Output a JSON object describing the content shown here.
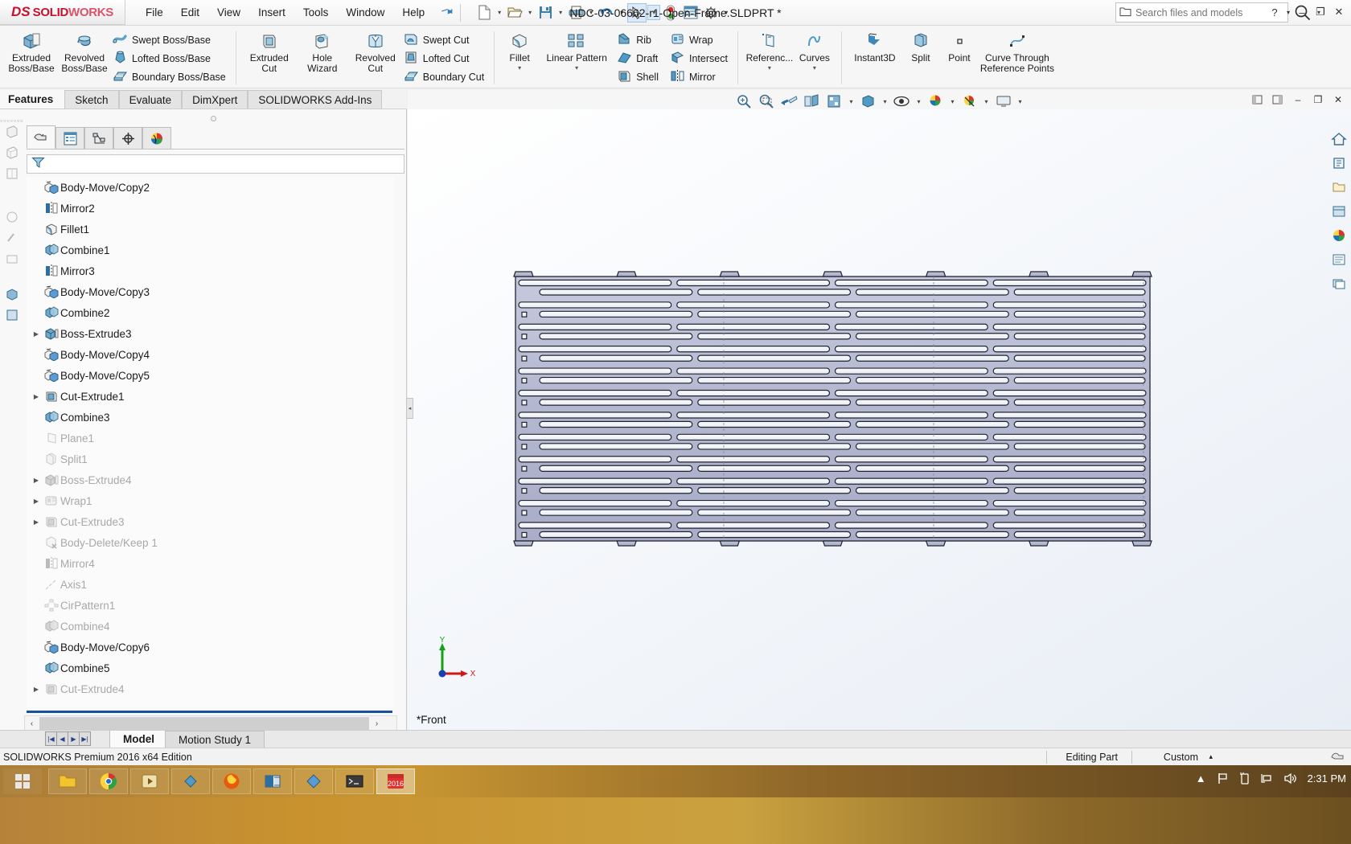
{
  "app": {
    "brand_ds": "DS",
    "brand_solid": "SOLID",
    "brand_works": "WORKS",
    "document_title": "NDC-03-06662-r1-Open-Frame.SLDPRT *",
    "accent_color": "#c8102e",
    "highlight_color": "#dce9f7"
  },
  "menubar": {
    "items": [
      "File",
      "Edit",
      "View",
      "Insert",
      "Tools",
      "Window",
      "Help"
    ]
  },
  "quick_access": {
    "items": [
      "new-document-icon",
      "open-document-icon",
      "save-icon",
      "print-icon",
      "undo-icon",
      "select-arrow-icon",
      "rebuild-icon",
      "options-list-icon",
      "settings-gear-icon"
    ]
  },
  "search": {
    "placeholder": "Search files and models",
    "value": ""
  },
  "window_controls": {
    "help": "?",
    "help_caret": "▾",
    "minimize": "–",
    "maximize": "❐",
    "close": "✕"
  },
  "ribbon": {
    "groups": [
      {
        "name": "boss-base",
        "big": [
          {
            "label_top": "Extruded",
            "label_bottom": "Boss/Base",
            "icon": "extruded-boss-icon"
          },
          {
            "label_top": "Revolved",
            "label_bottom": "Boss/Base",
            "icon": "revolved-boss-icon"
          }
        ],
        "small": [
          {
            "label": "Swept Boss/Base",
            "icon": "swept-boss-icon"
          },
          {
            "label": "Lofted Boss/Base",
            "icon": "lofted-boss-icon"
          },
          {
            "label": "Boundary Boss/Base",
            "icon": "boundary-boss-icon"
          }
        ]
      },
      {
        "name": "cut",
        "big": [
          {
            "label_top": "Extruded",
            "label_bottom": "Cut",
            "icon": "extruded-cut-icon"
          },
          {
            "label_top": "Hole",
            "label_bottom": "Wizard",
            "icon": "hole-wizard-icon"
          },
          {
            "label_top": "Revolved",
            "label_bottom": "Cut",
            "icon": "revolved-cut-icon"
          }
        ],
        "small": [
          {
            "label": "Swept Cut",
            "icon": "swept-cut-icon"
          },
          {
            "label": "Lofted Cut",
            "icon": "lofted-cut-icon"
          },
          {
            "label": "Boundary Cut",
            "icon": "boundary-cut-icon"
          }
        ]
      },
      {
        "name": "features",
        "big": [
          {
            "label_top": "Fillet",
            "label_bottom": "",
            "icon": "fillet-icon",
            "has_dropdown": true
          },
          {
            "label_top": "Linear Pattern",
            "label_bottom": "",
            "icon": "linear-pattern-icon",
            "has_dropdown": true
          }
        ],
        "small": [
          {
            "label": "Rib",
            "icon": "rib-icon"
          },
          {
            "label": "Draft",
            "icon": "draft-icon"
          },
          {
            "label": "Shell",
            "icon": "shell-icon"
          }
        ],
        "small2": [
          {
            "label": "Wrap",
            "icon": "wrap-icon"
          },
          {
            "label": "Intersect",
            "icon": "intersect-icon"
          },
          {
            "label": "Mirror",
            "icon": "mirror-icon"
          }
        ]
      },
      {
        "name": "reference",
        "big": [
          {
            "label_top": "Referenc...",
            "label_bottom": "",
            "icon": "reference-geometry-icon",
            "has_dropdown": true
          },
          {
            "label_top": "Curves",
            "label_bottom": "",
            "icon": "curves-icon",
            "has_dropdown": true
          }
        ]
      },
      {
        "name": "instant3d",
        "big": [
          {
            "label_top": "Instant3D",
            "label_bottom": "",
            "icon": "instant3d-icon"
          },
          {
            "label_top": "Split",
            "label_bottom": "",
            "icon": "split-icon"
          },
          {
            "label_top": "Point",
            "label_bottom": "",
            "icon": "point-icon"
          },
          {
            "label_top": "Curve Through",
            "label_bottom": "Reference Points",
            "icon": "curve-through-reference-points-icon"
          }
        ]
      }
    ]
  },
  "command_tabs": {
    "active": "Features",
    "items": [
      "Features",
      "Sketch",
      "Evaluate",
      "DimXpert",
      "SOLIDWORKS Add-Ins"
    ]
  },
  "feature_manager": {
    "tabs": [
      "feature-tree-icon",
      "property-manager-icon",
      "configuration-manager-icon",
      "dimxpert-manager-icon",
      "display-manager-icon"
    ],
    "active_tab_index": 0,
    "filter_placeholder": "",
    "expander": "›",
    "tree": [
      {
        "label": "Body-Move/Copy2",
        "icon": "body-move-copy-icon",
        "arrow": false,
        "suppressed": false
      },
      {
        "label": "Mirror2",
        "icon": "mirror-feature-icon",
        "arrow": false,
        "suppressed": false
      },
      {
        "label": "Fillet1",
        "icon": "fillet-feature-icon",
        "arrow": false,
        "suppressed": false
      },
      {
        "label": "Combine1",
        "icon": "combine-feature-icon",
        "arrow": false,
        "suppressed": false
      },
      {
        "label": "Mirror3",
        "icon": "mirror-feature-icon",
        "arrow": false,
        "suppressed": false
      },
      {
        "label": "Body-Move/Copy3",
        "icon": "body-move-copy-icon",
        "arrow": false,
        "suppressed": false
      },
      {
        "label": "Combine2",
        "icon": "combine-feature-icon",
        "arrow": false,
        "suppressed": false
      },
      {
        "label": "Boss-Extrude3",
        "icon": "boss-extrude-icon",
        "arrow": true,
        "suppressed": false
      },
      {
        "label": "Body-Move/Copy4",
        "icon": "body-move-copy-icon",
        "arrow": false,
        "suppressed": false
      },
      {
        "label": "Body-Move/Copy5",
        "icon": "body-move-copy-icon",
        "arrow": false,
        "suppressed": false
      },
      {
        "label": "Cut-Extrude1",
        "icon": "cut-extrude-icon",
        "arrow": true,
        "suppressed": false
      },
      {
        "label": "Combine3",
        "icon": "combine-feature-icon",
        "arrow": false,
        "suppressed": false
      },
      {
        "label": "Plane1",
        "icon": "plane-icon",
        "arrow": false,
        "suppressed": true
      },
      {
        "label": "Split1",
        "icon": "split-feature-icon",
        "arrow": false,
        "suppressed": true
      },
      {
        "label": "Boss-Extrude4",
        "icon": "boss-extrude-icon",
        "arrow": true,
        "suppressed": true
      },
      {
        "label": "Wrap1",
        "icon": "wrap-feature-icon",
        "arrow": true,
        "suppressed": true
      },
      {
        "label": "Cut-Extrude3",
        "icon": "cut-extrude-icon",
        "arrow": true,
        "suppressed": true
      },
      {
        "label": "Body-Delete/Keep 1",
        "icon": "body-delete-keep-icon",
        "arrow": false,
        "suppressed": true
      },
      {
        "label": "Mirror4",
        "icon": "mirror-feature-icon",
        "arrow": false,
        "suppressed": true
      },
      {
        "label": "Axis1",
        "icon": "axis-icon",
        "arrow": false,
        "suppressed": true
      },
      {
        "label": "CirPattern1",
        "icon": "circular-pattern-icon",
        "arrow": false,
        "suppressed": true
      },
      {
        "label": "Combine4",
        "icon": "combine-feature-icon",
        "arrow": false,
        "suppressed": true
      },
      {
        "label": "Body-Move/Copy6",
        "icon": "body-move-copy-icon",
        "arrow": false,
        "suppressed": false
      },
      {
        "label": "Combine5",
        "icon": "combine-feature-icon",
        "arrow": false,
        "suppressed": false
      },
      {
        "label": "Cut-Extrude4",
        "icon": "cut-extrude-icon",
        "arrow": true,
        "suppressed": true
      }
    ]
  },
  "document_tabs": {
    "active": "Model",
    "items": [
      "Model",
      "Motion Study 1"
    ],
    "nav_buttons": [
      "first",
      "prev",
      "next",
      "last"
    ]
  },
  "graphics": {
    "view_label": "*Front",
    "triad": {
      "x_axis": "X",
      "y_axis": "Y"
    },
    "toolbar_icons": [
      "zoom-to-fit-icon",
      "zoom-to-area-icon",
      "previous-view-icon",
      "section-view-icon",
      "view-orientation-icon",
      "display-style-icon",
      "hide-show-items-icon",
      "edit-appearance-icon",
      "apply-scene-icon",
      "view-settings-icon"
    ],
    "sidebar_icons": [
      "home-icon",
      "solidworks-resources-icon",
      "design-library-icon",
      "file-explorer-icon",
      "view-palette-icon",
      "appearances-scenes-icon",
      "custom-properties-icon",
      "solidworks-forum-icon"
    ]
  },
  "status_bar": {
    "version": "SOLIDWORKS Premium 2016 x64 Edition",
    "editing_state": "Editing Part",
    "units": "Custom",
    "units_caret": "▴"
  },
  "taskbar": {
    "clock": "2:31 PM",
    "apps": [
      "start-icon",
      "file-explorer-icon",
      "chrome-icon",
      "media-icon",
      "network-icon",
      "firefox-icon",
      "outlook-icon",
      "app-icon",
      "terminal-icon",
      "solidworks-2016-icon"
    ],
    "tray": [
      "show-hidden-icon",
      "flag-icon",
      "battery-icon",
      "network-icon",
      "volume-icon"
    ]
  }
}
